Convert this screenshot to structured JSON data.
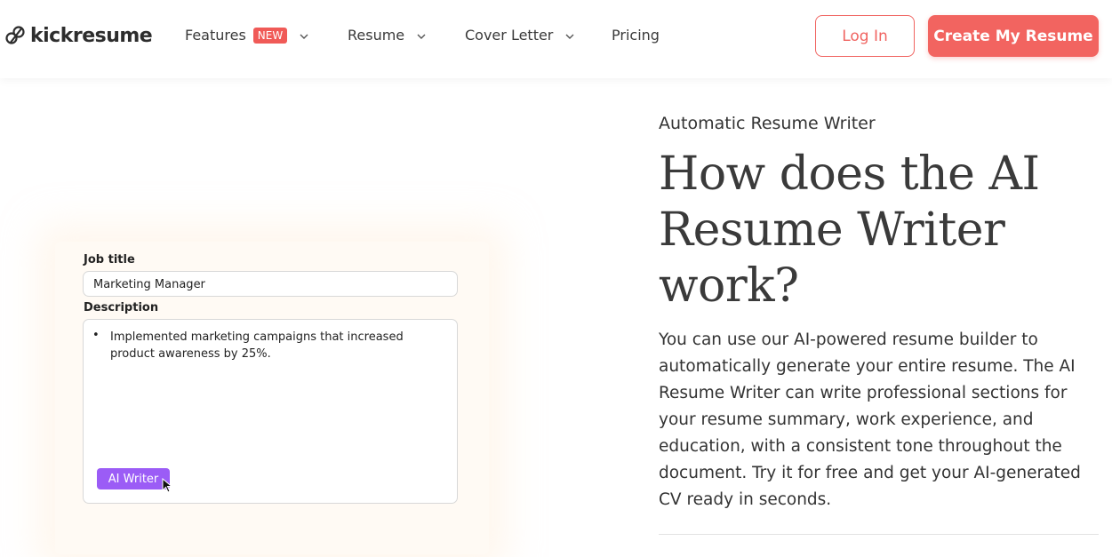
{
  "header": {
    "logo_text": "kickresume",
    "nav": [
      {
        "label": "Features",
        "badge": "NEW"
      },
      {
        "label": "Resume"
      },
      {
        "label": "Cover Letter"
      },
      {
        "label": "Pricing"
      }
    ],
    "login_label": "Log In",
    "create_label": "Create My Resume"
  },
  "illustration": {
    "job_title_label": "Job title",
    "job_title_value": "Marketing Manager",
    "description_label": "Description",
    "description_bullet": "•",
    "description_text": "Implemented marketing campaigns that increased product awareness by 25%.",
    "ai_button_label": "AI Writer"
  },
  "content": {
    "eyebrow": "Automatic Resume Writer",
    "headline": "How does the AI Resume Writer work?",
    "body": "You can use our AI-powered resume builder to automatically generate your entire resume. The AI Resume Writer can write professional sections for your resume summary, work experience, and education, with a consistent tone throughout the document. Try it for free and get your AI-generated CV ready in seconds."
  },
  "colors": {
    "brand_red": "#f26460",
    "ai_purple": "#9b5cf6",
    "illus_bg": "#fffaf4"
  }
}
